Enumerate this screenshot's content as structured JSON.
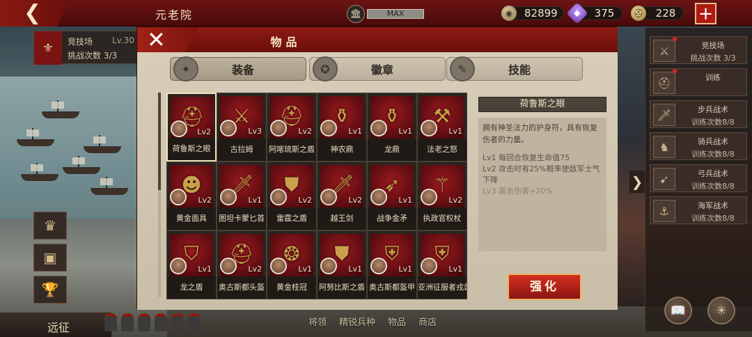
{
  "topbar": {
    "title": "元老院",
    "fame_bar": "MAX",
    "coins": "82899",
    "gems": "375",
    "honor": "228"
  },
  "left_hud": {
    "arena_name": "竞技场",
    "arena_level": "Lv.30",
    "arena_challenges": "挑战次数",
    "arena_challenges_count": "3/3",
    "expedition_label": "远征"
  },
  "bottom_nav": [
    "将领",
    "精锐兵种",
    "物品",
    "商店"
  ],
  "right_tasks": [
    {
      "title": "竞技场",
      "sub": "挑战次数 3/3",
      "icon": "crossed-swords-icon",
      "glyph": "⚔",
      "dot": true
    },
    {
      "title": "训练",
      "sub": "",
      "icon": "helmet-icon",
      "glyph": "⛑",
      "dot": true
    },
    {
      "title": "步兵战术",
      "sub": "训练次数8/8",
      "icon": "sword-icon",
      "glyph": "🗡",
      "dot": false
    },
    {
      "title": "骑兵战术",
      "sub": "训练次数8/8",
      "icon": "horse-icon",
      "glyph": "♞",
      "dot": false
    },
    {
      "title": "弓兵战术",
      "sub": "训练次数8/8",
      "icon": "bow-icon",
      "glyph": "➹",
      "dot": false
    },
    {
      "title": "海军战术",
      "sub": "训练次数8/8",
      "icon": "anchor-icon",
      "glyph": "⚓",
      "dot": false
    }
  ],
  "dialog": {
    "title": "物品",
    "tabs": [
      {
        "label": "装备",
        "icon": "armor-icon",
        "glyph": "✦",
        "active": true
      },
      {
        "label": "徽章",
        "icon": "badge-icon",
        "glyph": "✪",
        "active": false
      },
      {
        "label": "技能",
        "icon": "scroll-icon",
        "glyph": "✎",
        "active": false
      }
    ],
    "items": [
      {
        "name": "荷鲁斯之眼",
        "level": "Lv2",
        "glyph": "⛑",
        "selected": true
      },
      {
        "name": "古拉姆",
        "level": "Lv3",
        "glyph": "⚔"
      },
      {
        "name": "阿喀琉斯之盾",
        "level": "Lv2",
        "glyph": "⛑"
      },
      {
        "name": "神农鼎",
        "level": "Lv1",
        "glyph": "⚱"
      },
      {
        "name": "龙鼎",
        "level": "Lv1",
        "glyph": "⚱"
      },
      {
        "name": "法老之怒",
        "level": "Lv1",
        "glyph": "⚒"
      },
      {
        "name": "黄金面具",
        "level": "Lv2",
        "glyph": "☻"
      },
      {
        "name": "图坦卡蒙匕首",
        "level": "Lv1",
        "glyph": "🗡"
      },
      {
        "name": "雷霆之盾",
        "level": "Lv2",
        "glyph": "⛊"
      },
      {
        "name": "越王剑",
        "level": "Lv2",
        "glyph": "🗡"
      },
      {
        "name": "战争金矛",
        "level": "Lv1",
        "glyph": "➶"
      },
      {
        "name": "执政官权杖",
        "level": "Lv2",
        "glyph": "⚚"
      },
      {
        "name": "龙之盾",
        "level": "Lv1",
        "glyph": "⛉"
      },
      {
        "name": "奥古斯都头盔",
        "level": "Lv2",
        "glyph": "⛑"
      },
      {
        "name": "黄金桂冠",
        "level": "Lv1",
        "glyph": "❂"
      },
      {
        "name": "阿努比斯之盾",
        "level": "Lv1",
        "glyph": "⛊"
      },
      {
        "name": "奥古斯都盔甲",
        "level": "Lv1",
        "glyph": "⛨"
      },
      {
        "name": "亚洲征服者戎装",
        "level": "Lv1",
        "glyph": "⛨"
      }
    ],
    "detail": {
      "title": "荷鲁斯之眼",
      "description": "拥有神圣法力的护身符，具有恢复伤者的力量。",
      "levels": [
        "Lv1 每回合恢复生命值75",
        "Lv2 攻击时有25%概率使敌军士气下降",
        "Lv3 暴击伤害+20%"
      ]
    },
    "enhance_label": "强化"
  },
  "colors": {
    "accent_red": "#8e1a14",
    "button_red": "#d43020",
    "panel_bg": "#d2c7b2"
  }
}
